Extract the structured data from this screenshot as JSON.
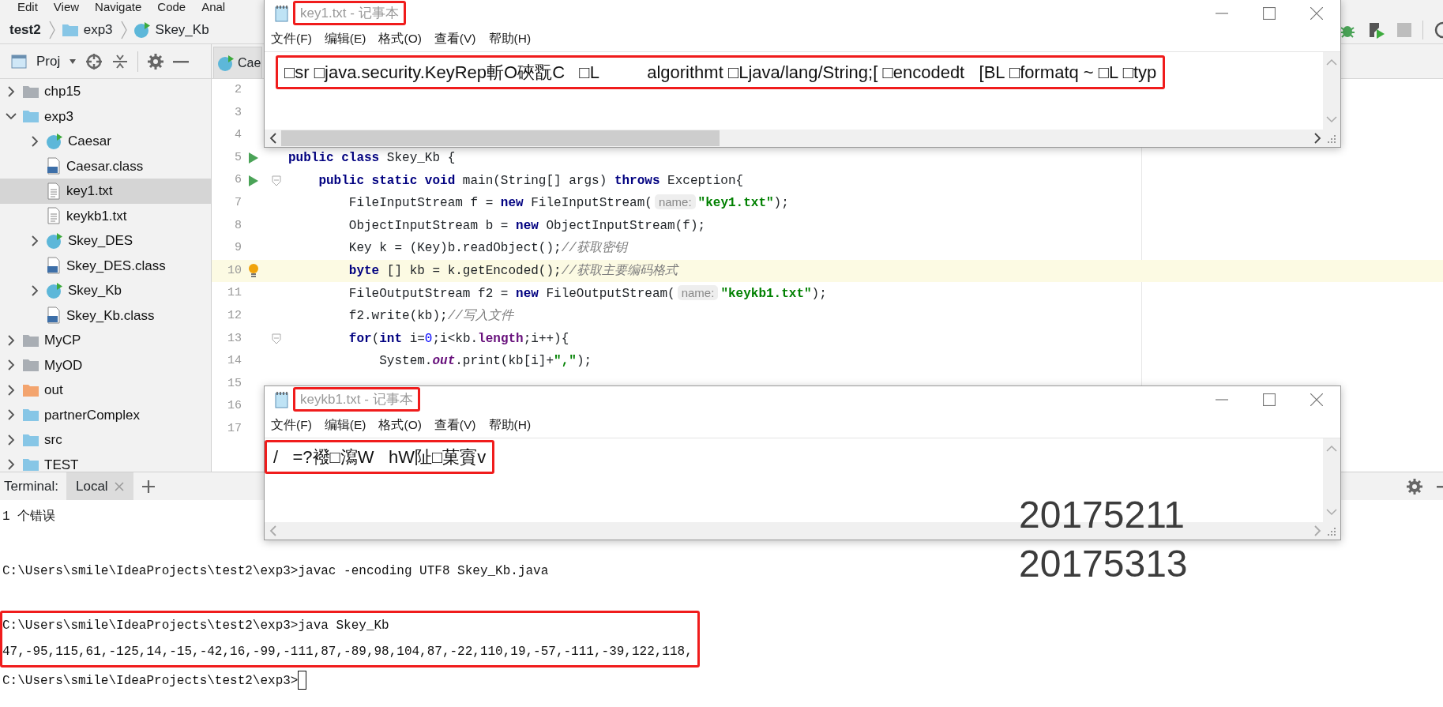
{
  "menu_bar": [
    "Edit",
    "View",
    "Navigate",
    "Code",
    "Anal"
  ],
  "breadcrumbs": [
    {
      "label": "test2",
      "kind": "project"
    },
    {
      "label": "exp3",
      "kind": "folder"
    },
    {
      "label": "Skey_Kb",
      "kind": "class"
    }
  ],
  "project_panel": {
    "title": "Proj"
  },
  "project_tree": [
    {
      "label": "chp15",
      "kind": "folder",
      "color": "#a9aeb4",
      "expanded": false,
      "selected": false
    },
    {
      "label": "exp3",
      "kind": "folder",
      "color": "#87c6e6",
      "expanded": true,
      "selected": false,
      "children": [
        {
          "label": "Caesar",
          "kind": "class",
          "expanded": false,
          "selected": false
        },
        {
          "label": "Caesar.class",
          "kind": "classfile",
          "selected": false
        },
        {
          "label": "key1.txt",
          "kind": "text",
          "selected": true
        },
        {
          "label": "keykb1.txt",
          "kind": "text",
          "selected": false
        },
        {
          "label": "Skey_DES",
          "kind": "class",
          "expanded": false,
          "selected": false
        },
        {
          "label": "Skey_DES.class",
          "kind": "classfile",
          "selected": false
        },
        {
          "label": "Skey_Kb",
          "kind": "class",
          "expanded": false,
          "selected": false
        },
        {
          "label": "Skey_Kb.class",
          "kind": "classfile",
          "selected": false
        }
      ]
    },
    {
      "label": "MyCP",
      "kind": "folder",
      "color": "#a9aeb4",
      "expanded": false,
      "selected": false
    },
    {
      "label": "MyOD",
      "kind": "folder",
      "color": "#a9aeb4",
      "expanded": false,
      "selected": false
    },
    {
      "label": "out",
      "kind": "folder",
      "color": "#f3a46e",
      "expanded": false,
      "selected": false
    },
    {
      "label": "partnerComplex",
      "kind": "folder",
      "color": "#87c6e6",
      "expanded": false,
      "selected": false
    },
    {
      "label": "src",
      "kind": "folder",
      "color": "#87c6e6",
      "expanded": false,
      "selected": false
    },
    {
      "label": "TEST",
      "kind": "folder",
      "color": "#87c6e6",
      "expanded": false,
      "selected": false
    }
  ],
  "editor": {
    "tabs": [
      {
        "label": "Cae",
        "kind": "class",
        "selected": false
      }
    ],
    "lines": [
      {
        "number": "2",
        "current": false
      },
      {
        "number": "3",
        "current": false
      },
      {
        "number": "4",
        "current": false
      },
      {
        "number": "5",
        "current": false,
        "run": true,
        "segments": [
          {
            "kind": "keyword",
            "text": "public class"
          },
          {
            "kind": "plain",
            "text": " Skey_Kb {"
          }
        ]
      },
      {
        "number": "6",
        "current": false,
        "run": true,
        "fold": true,
        "segments": [
          {
            "kind": "keyword",
            "text": "    public static void"
          },
          {
            "kind": "plain",
            "text": " main(String[] args) "
          },
          {
            "kind": "keyword",
            "text": "throws"
          },
          {
            "kind": "plain",
            "text": " Exception{"
          }
        ]
      },
      {
        "number": "7",
        "current": false,
        "segments": [
          {
            "kind": "plain",
            "text": "        FileInputStream f = "
          },
          {
            "kind": "keyword",
            "text": "new"
          },
          {
            "kind": "plain",
            "text": " FileInputStream("
          },
          {
            "kind": "hint",
            "text": "name:"
          },
          {
            "kind": "string",
            "text": "\"key1.txt\""
          },
          {
            "kind": "plain",
            "text": ");"
          }
        ]
      },
      {
        "number": "8",
        "current": false,
        "segments": [
          {
            "kind": "plain",
            "text": "        ObjectInputStream b = "
          },
          {
            "kind": "keyword",
            "text": "new"
          },
          {
            "kind": "plain",
            "text": " ObjectInputStream(f);"
          }
        ]
      },
      {
        "number": "9",
        "current": false,
        "segments": [
          {
            "kind": "plain",
            "text": "        Key k = (Key)b.readObject();"
          },
          {
            "kind": "comment",
            "text": "//获取密钥"
          }
        ]
      },
      {
        "number": "10",
        "current": true,
        "bulb": true,
        "segments": [
          {
            "kind": "keyword",
            "text": "        byte"
          },
          {
            "kind": "plain",
            "text": " [] kb = k.getEncoded();"
          },
          {
            "kind": "comment",
            "text": "//获取主要编码格式"
          }
        ]
      },
      {
        "number": "11",
        "current": false,
        "segments": [
          {
            "kind": "plain",
            "text": "        FileOutputStream f2 = "
          },
          {
            "kind": "keyword",
            "text": "new"
          },
          {
            "kind": "plain",
            "text": " FileOutputStream("
          },
          {
            "kind": "hint",
            "text": "name:"
          },
          {
            "kind": "string",
            "text": "\"keykb1.txt\""
          },
          {
            "kind": "plain",
            "text": ");"
          }
        ]
      },
      {
        "number": "12",
        "current": false,
        "segments": [
          {
            "kind": "plain",
            "text": "        f2.write(kb);"
          },
          {
            "kind": "comment",
            "text": "//写入文件"
          }
        ]
      },
      {
        "number": "13",
        "current": false,
        "fold": true,
        "segments": [
          {
            "kind": "keyword",
            "text": "        for"
          },
          {
            "kind": "plain",
            "text": "("
          },
          {
            "kind": "keyword",
            "text": "int"
          },
          {
            "kind": "plain",
            "text": " i="
          },
          {
            "kind": "number",
            "text": "0"
          },
          {
            "kind": "plain",
            "text": ";i<kb."
          },
          {
            "kind": "field",
            "text": "length"
          },
          {
            "kind": "plain",
            "text": ";i++){"
          }
        ]
      },
      {
        "number": "14",
        "current": false,
        "segments": [
          {
            "kind": "plain",
            "text": "            System."
          },
          {
            "kind": "static",
            "text": "out"
          },
          {
            "kind": "plain",
            "text": ".print(kb[i]+"
          },
          {
            "kind": "string",
            "text": "\",\""
          },
          {
            "kind": "plain",
            "text": ");"
          }
        ]
      },
      {
        "number": "15",
        "current": false
      },
      {
        "number": "16",
        "current": false
      },
      {
        "number": "17",
        "current": false
      }
    ]
  },
  "terminal": {
    "title": "Terminal:",
    "tabs": [
      {
        "label": "Local",
        "selected": true
      }
    ],
    "lines": [
      {
        "kind": "output",
        "text": "1 个错误",
        "boxed": false
      },
      {
        "kind": "command",
        "text": "C:\\Users\\smile\\IdeaProjects\\test2\\exp3>javac -encoding UTF8 Skey_Kb.java",
        "boxed": false
      },
      {
        "kind": "command",
        "text": "C:\\Users\\smile\\IdeaProjects\\test2\\exp3>java Skey_Kb",
        "boxed": true
      },
      {
        "kind": "output",
        "text": "47,-95,115,61,-125,14,-15,-42,16,-99,-111,87,-89,98,104,87,-22,110,19,-57,-111,-39,122,118,",
        "boxed": true
      },
      {
        "kind": "prompt",
        "text": "C:\\Users\\smile\\IdeaProjects\\test2\\exp3>",
        "boxed": false,
        "cursor": true
      }
    ]
  },
  "notepads": [
    {
      "title": "key1.txt - 记事本",
      "title_boxed": true,
      "menu": [
        "文件(F)",
        "编辑(E)",
        "格式(O)",
        "查看(V)",
        "帮助(H)"
      ],
      "content": "□sr □java.security.KeyRep斬O硤翫C   □L          algorithmt □Ljava/lang/String;[ □encodedt   [BL □formatq ~ □L □typ",
      "content_boxed": true,
      "overflow": true
    },
    {
      "title": "keykb1.txt - 记事本",
      "title_boxed": true,
      "menu": [
        "文件(F)",
        "编辑(E)",
        "格式(O)",
        "查看(V)",
        "帮助(H)"
      ],
      "content": "/   =?襏□瀉W   hW阯□菓賨v",
      "content_boxed": true,
      "overflow": false
    }
  ],
  "overlay_text": [
    "20175211",
    "20175313"
  ]
}
